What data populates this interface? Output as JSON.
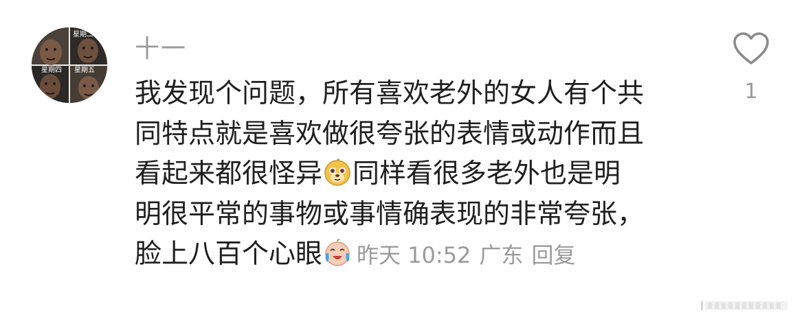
{
  "avatar": {
    "labels": [
      "星期二",
      "星期四",
      "星期五"
    ]
  },
  "comment": {
    "author": "十一",
    "body_lines": [
      "我发现个问题，所有喜欢老外的女人有个共",
      "同特点就是喜欢做很夸张的表情或动作而且",
      "看起来都很怪异",
      "同样看很多老外也是明",
      "明很平常的事物或事情确表现的非常夸张，",
      "脸上八百个心眼"
    ],
    "emojis": [
      "dog-face-emoji",
      "crying-laughing-emoji"
    ],
    "time": "昨天 10:52",
    "location": "广东",
    "reply_label": "回复",
    "like_count": "1",
    "like_icon": "heart-icon"
  },
  "colors": {
    "text": "#1f1f1f",
    "muted": "#9a9a9a",
    "background": "#ffffff"
  }
}
